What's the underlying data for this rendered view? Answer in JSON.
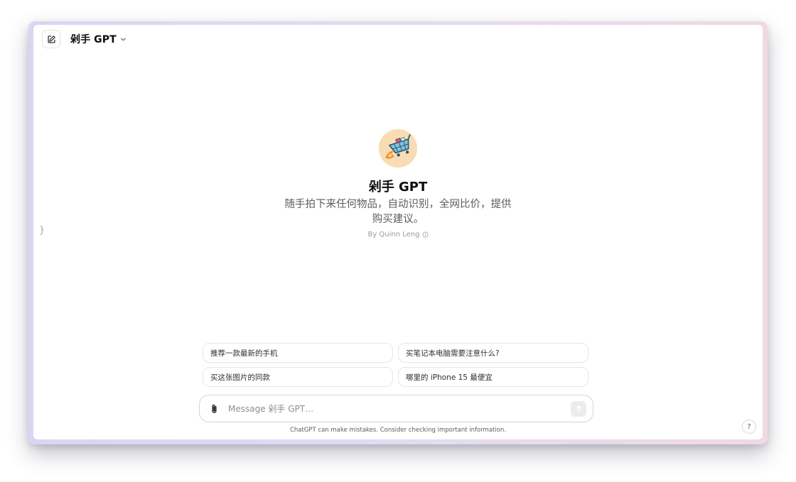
{
  "header": {
    "title": "剁手 GPT",
    "new_chat_icon": "edit-icon",
    "dropdown_icon": "chevron-down-icon"
  },
  "sidebar": {
    "toggle_glyph": "}"
  },
  "hero": {
    "name": "剁手 GPT",
    "description": "随手拍下来任何物品，自动识别，全网比价，提供购买建议。",
    "author": "By Quinn Leng",
    "author_icon": "info-icon"
  },
  "suggestions": [
    "推荐一款最新的手机",
    "买笔记本电脑需要注意什么?",
    "买这张图片的同款",
    "哪里的 iPhone 15 最便宜"
  ],
  "composer": {
    "placeholder": "Message 剁手 GPT…",
    "attach_icon": "paperclip-icon",
    "send_icon": "arrow-up-icon"
  },
  "footer": {
    "disclaimer": "ChatGPT can make mistakes. Consider checking important information.",
    "help_label": "?"
  },
  "colors": {
    "text_primary": "#0d0d0d",
    "text_secondary": "#5d5d5d",
    "border": "#e5e5e5",
    "avatar_bg": "#f7dcb4"
  }
}
